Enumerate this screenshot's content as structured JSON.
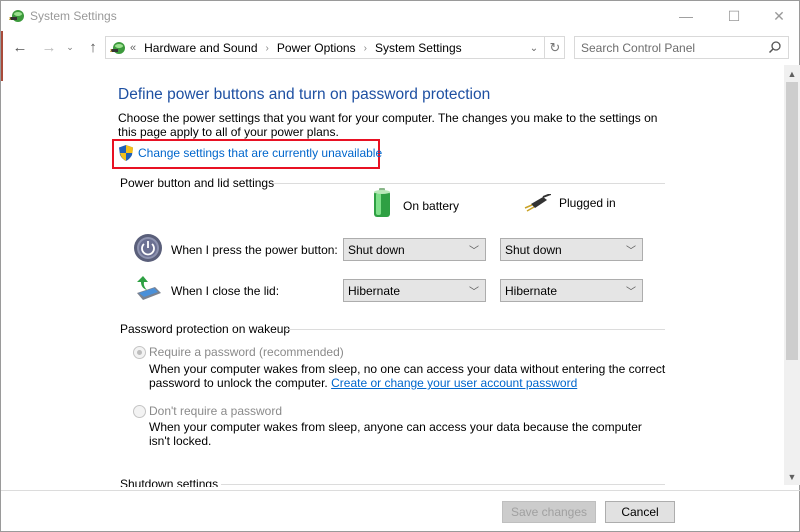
{
  "window": {
    "title": "System Settings",
    "controls": {
      "minimize": "—",
      "maximize": "☐",
      "close": "✕"
    }
  },
  "nav": {
    "back": "←",
    "forward": "→",
    "recent": "⌄",
    "up": "↑",
    "overflow": "«",
    "breadcrumbs": [
      "Hardware and Sound",
      "Power Options",
      "System Settings"
    ],
    "separator": "›",
    "dropdown": "⌄",
    "refresh": "↻"
  },
  "search": {
    "placeholder": "Search Control Panel",
    "value": ""
  },
  "page": {
    "heading": "Define power buttons and turn on password protection",
    "intro": "Choose the power settings that you want for your computer. The changes you make to the settings on this page apply to all of your power plans.",
    "uac_link": "Change settings that are currently unavailable",
    "uac_highlight_color": "#e81123"
  },
  "power_section": {
    "title": "Power button and lid settings",
    "columns": [
      "On battery",
      "Plugged in"
    ],
    "rows": [
      {
        "label": "When I press the power button:",
        "on_battery": "Shut down",
        "plugged_in": "Shut down"
      },
      {
        "label": "When I close the lid:",
        "on_battery": "Hibernate",
        "plugged_in": "Hibernate"
      }
    ]
  },
  "password_section": {
    "title": "Password protection on wakeup",
    "options": [
      {
        "label": "Require a password (recommended)",
        "selected": true,
        "desc": "When your computer wakes from sleep, no one can access your data without entering the correct password to unlock the computer.",
        "link": "Create or change your user account password"
      },
      {
        "label": "Don't require a password",
        "selected": false,
        "desc": "When your computer wakes from sleep, anyone can access your data because the computer isn't locked."
      }
    ]
  },
  "shutdown_section": {
    "title": "Shutdown settings"
  },
  "footer": {
    "save": "Save changes",
    "cancel": "Cancel"
  },
  "colors": {
    "heading": "#1e50a2",
    "link": "#0066cc"
  }
}
